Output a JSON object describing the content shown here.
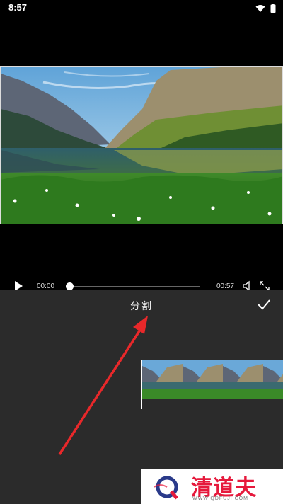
{
  "status_bar": {
    "time": "8:57"
  },
  "player": {
    "current_time": "00:00",
    "total_time": "00:57",
    "progress": 0.0
  },
  "editor": {
    "title": "分割"
  },
  "watermark": {
    "text": "清道夫",
    "url": "WWW.QDFUJI.COM"
  },
  "colors": {
    "panel": "#2b2b2b",
    "accent": "#e6193c",
    "arrow": "#e8282a"
  },
  "icons": [
    "wifi-icon",
    "battery-icon",
    "play-icon",
    "volume-icon",
    "expand-icon",
    "checkmark-icon"
  ]
}
